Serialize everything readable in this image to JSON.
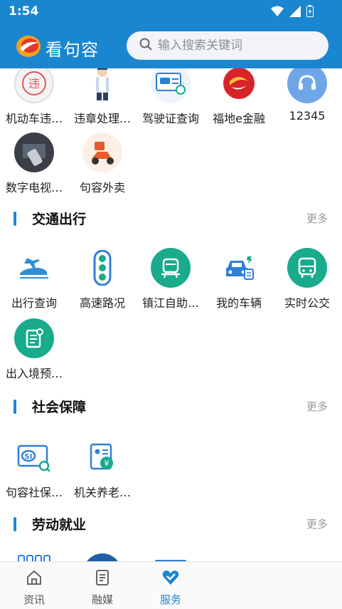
{
  "status": {
    "time": "1:54"
  },
  "app": {
    "title": "看句容"
  },
  "search": {
    "placeholder": "输入搜索关键词"
  },
  "top_items": [
    {
      "label": "机动车违…"
    },
    {
      "label": "违章处理…"
    },
    {
      "label": "驾驶证查询"
    },
    {
      "label": "福地e金融"
    },
    {
      "label": "12345"
    },
    {
      "label": "数字电视…"
    },
    {
      "label": "句容外卖"
    }
  ],
  "sections": [
    {
      "title": "交通出行",
      "more": "更多",
      "items": [
        {
          "label": "出行查询"
        },
        {
          "label": "高速路况"
        },
        {
          "label": "镇江自助…"
        },
        {
          "label": "我的车辆"
        },
        {
          "label": "实时公交"
        },
        {
          "label": "出入境预…"
        }
      ]
    },
    {
      "title": "社会保障",
      "more": "更多",
      "items": [
        {
          "label": "句容社保…"
        },
        {
          "label": "机关养老…"
        }
      ]
    },
    {
      "title": "劳动就业",
      "more": "更多",
      "items": []
    }
  ],
  "tabs": [
    {
      "label": "资讯"
    },
    {
      "label": "融媒"
    },
    {
      "label": "服务"
    }
  ],
  "colors": {
    "brand": "#1a86d0",
    "teal": "#1aaa8c"
  }
}
